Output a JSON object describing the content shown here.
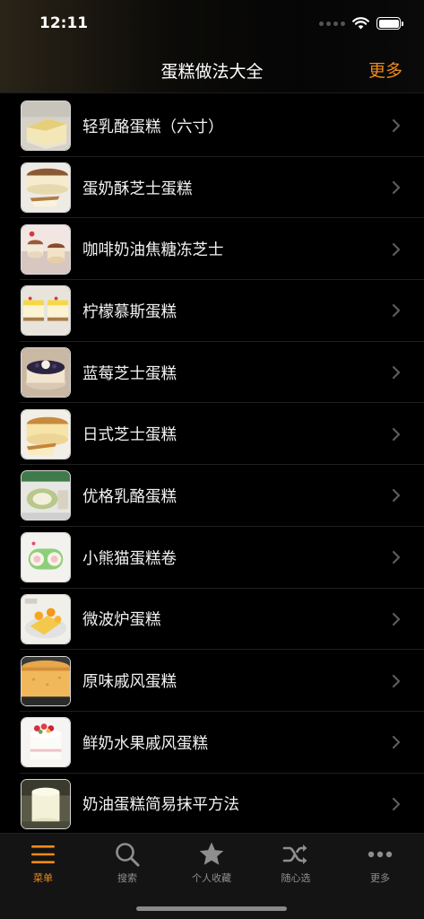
{
  "status_bar": {
    "time": "12:11",
    "battery_level": 1.0,
    "icons": [
      "signal-dots-icon",
      "wifi-icon",
      "battery-icon"
    ]
  },
  "nav": {
    "title": "蛋糕做法大全",
    "more_label": "更多"
  },
  "theme": {
    "accent": "#f08a1a",
    "background": "#000000"
  },
  "recipes": [
    {
      "label": "轻乳酪蛋糕（六寸）"
    },
    {
      "label": "蛋奶酥芝士蛋糕"
    },
    {
      "label": "咖啡奶油焦糖冻芝士"
    },
    {
      "label": "柠檬慕斯蛋糕"
    },
    {
      "label": "蓝莓芝士蛋糕"
    },
    {
      "label": "日式芝士蛋糕"
    },
    {
      "label": "优格乳酪蛋糕"
    },
    {
      "label": "小熊猫蛋糕卷"
    },
    {
      "label": "微波炉蛋糕"
    },
    {
      "label": "原味戚风蛋糕"
    },
    {
      "label": "鲜奶水果戚风蛋糕"
    },
    {
      "label": "奶油蛋糕简易抹平方法"
    }
  ],
  "tabs": [
    {
      "label": "菜单",
      "icon": "menu-icon",
      "active": true
    },
    {
      "label": "搜索",
      "icon": "search-icon",
      "active": false
    },
    {
      "label": "个人收藏",
      "icon": "star-icon",
      "active": false
    },
    {
      "label": "随心选",
      "icon": "shuffle-icon",
      "active": false
    },
    {
      "label": "更多",
      "icon": "ellipsis-icon",
      "active": false
    }
  ]
}
